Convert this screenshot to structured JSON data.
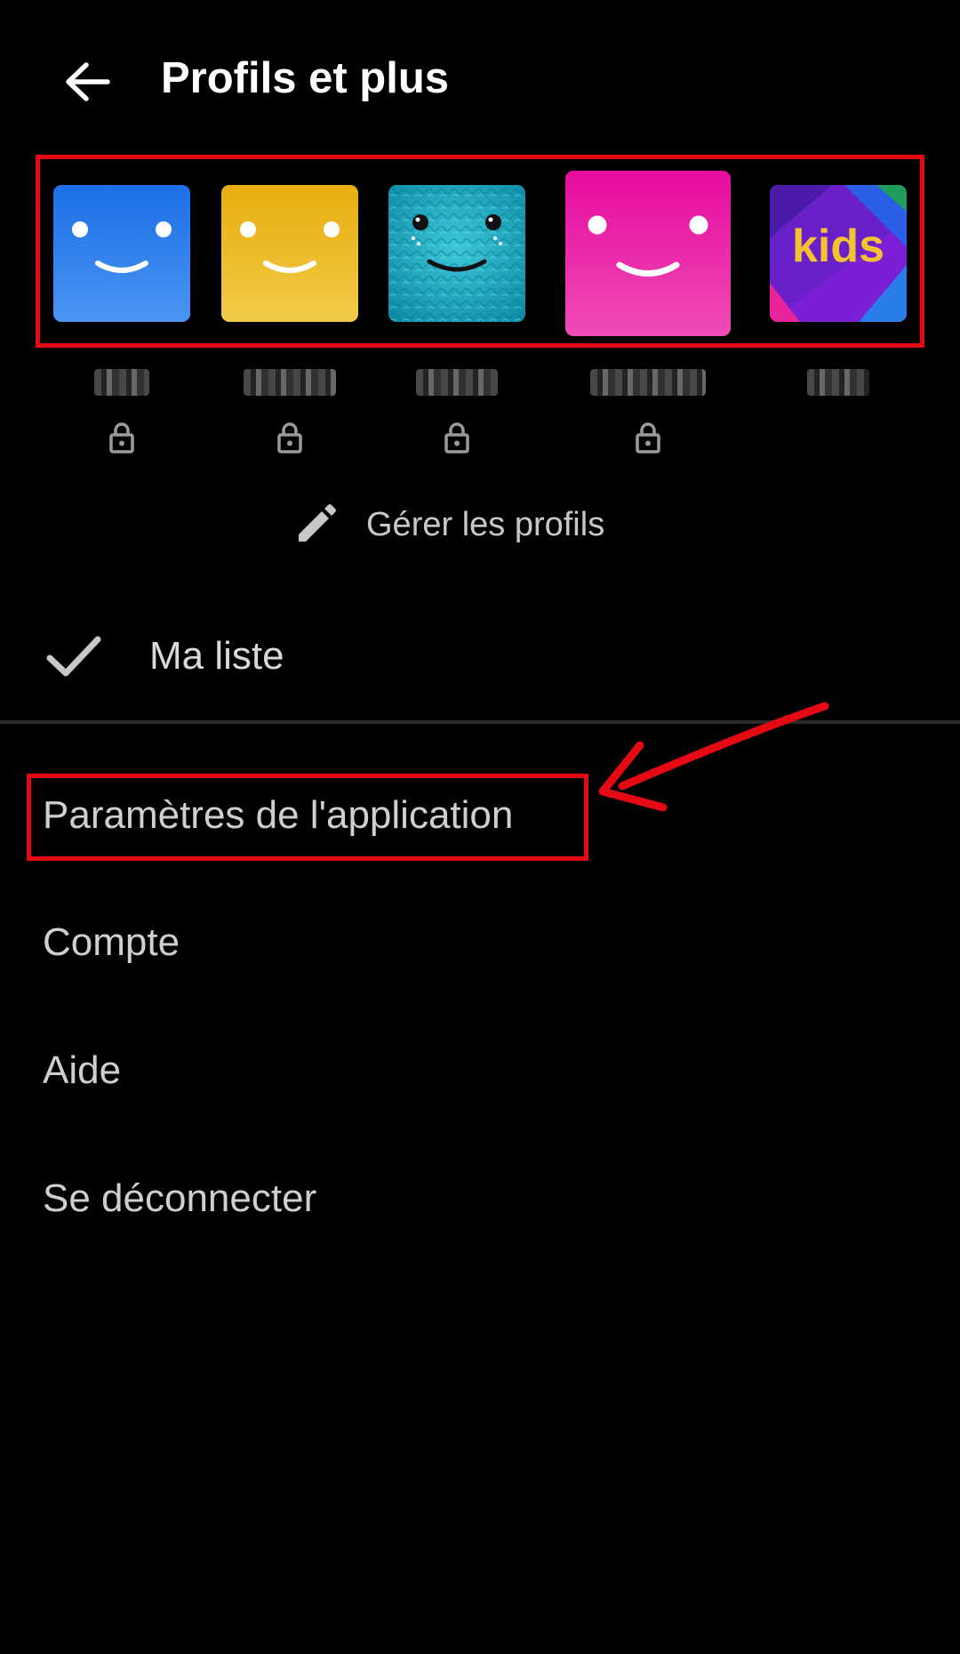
{
  "header": {
    "title": "Profils et plus"
  },
  "profiles": [
    {
      "name": "▒▒▒",
      "locked": true,
      "avatar": "smiley-blue"
    },
    {
      "name": "▒▒▒▒▒",
      "locked": true,
      "avatar": "smiley-yellow"
    },
    {
      "name": "▒▒▒▒",
      "locked": true,
      "avatar": "furry-teal"
    },
    {
      "name": "▒▒▒▒▒▒",
      "locked": true,
      "avatar": "smiley-pink"
    },
    {
      "name": "▒▒▒",
      "locked": false,
      "avatar": "kids"
    }
  ],
  "kids_label": "kids",
  "manage": {
    "label": "Gérer les profils"
  },
  "my_list": {
    "label": "Ma liste"
  },
  "menu": {
    "app_settings": "Paramètres de l'application",
    "account": "Compte",
    "help": "Aide",
    "sign_out": "Se déconnecter"
  },
  "colors": {
    "background": "#000000",
    "highlight": "#e50914",
    "blue": "#2e7ff0",
    "yellow": "#eab51a",
    "teal": "#1fb3c9",
    "pink": "#e81ea8",
    "kids_purple": "#7b1fd6",
    "kids_text": "#f2c230"
  },
  "icons": {
    "back": "arrow-left-icon",
    "lock": "lock-icon",
    "pencil": "pencil-icon",
    "check": "check-icon"
  }
}
